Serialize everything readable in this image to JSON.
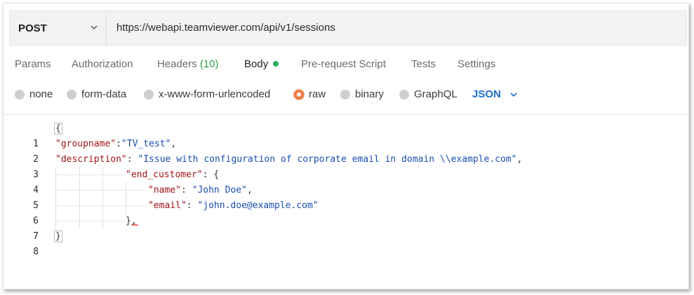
{
  "request": {
    "method": "POST",
    "url": "https://webapi.teamviewer.com/api/v1/sessions"
  },
  "tabs": [
    {
      "label": "Params"
    },
    {
      "label": "Authorization"
    },
    {
      "label": "Headers",
      "count": "(10)"
    },
    {
      "label": "Body",
      "active": true,
      "indicator_color": "#27ae60"
    },
    {
      "label": "Pre-request Script"
    },
    {
      "label": "Tests"
    },
    {
      "label": "Settings"
    }
  ],
  "body_options": [
    {
      "label": "none"
    },
    {
      "label": "form-data"
    },
    {
      "label": "x-www-form-urlencoded"
    },
    {
      "label": "raw",
      "selected": true
    },
    {
      "label": "binary"
    },
    {
      "label": "GraphQL"
    }
  ],
  "format": {
    "selected": "JSON",
    "color": "#1a6fc9"
  },
  "editor": {
    "line_numbers": [
      "1",
      "2",
      "3",
      "4",
      "5",
      "6",
      "7",
      "8"
    ],
    "lines": {
      "l1": "{",
      "l2_key": "\"groupname\"",
      "l2_sep": ":",
      "l2_val": "\"TV_test\"",
      "l2_end": ",",
      "l3_key": "\"description\"",
      "l3_sep": ": ",
      "l3_val": "\"Issue with configuration of corporate email in domain \\\\example.com\"",
      "l3_end": ",",
      "l4_key": "\"end_customer\"",
      "l4_sep": ": {",
      "l5_key": "\"name\"",
      "l5_sep": ": ",
      "l5_val": "\"John Doe\"",
      "l5_end": ",",
      "l6_key": "\"email\"",
      "l6_sep": ": ",
      "l6_val": "\"john.doe@example.com\"",
      "l7": "},",
      "l8": "}"
    }
  },
  "colors": {
    "accent_orange": "#f07a43",
    "json_key": "#a31515",
    "json_string": "#1a4fb0"
  }
}
